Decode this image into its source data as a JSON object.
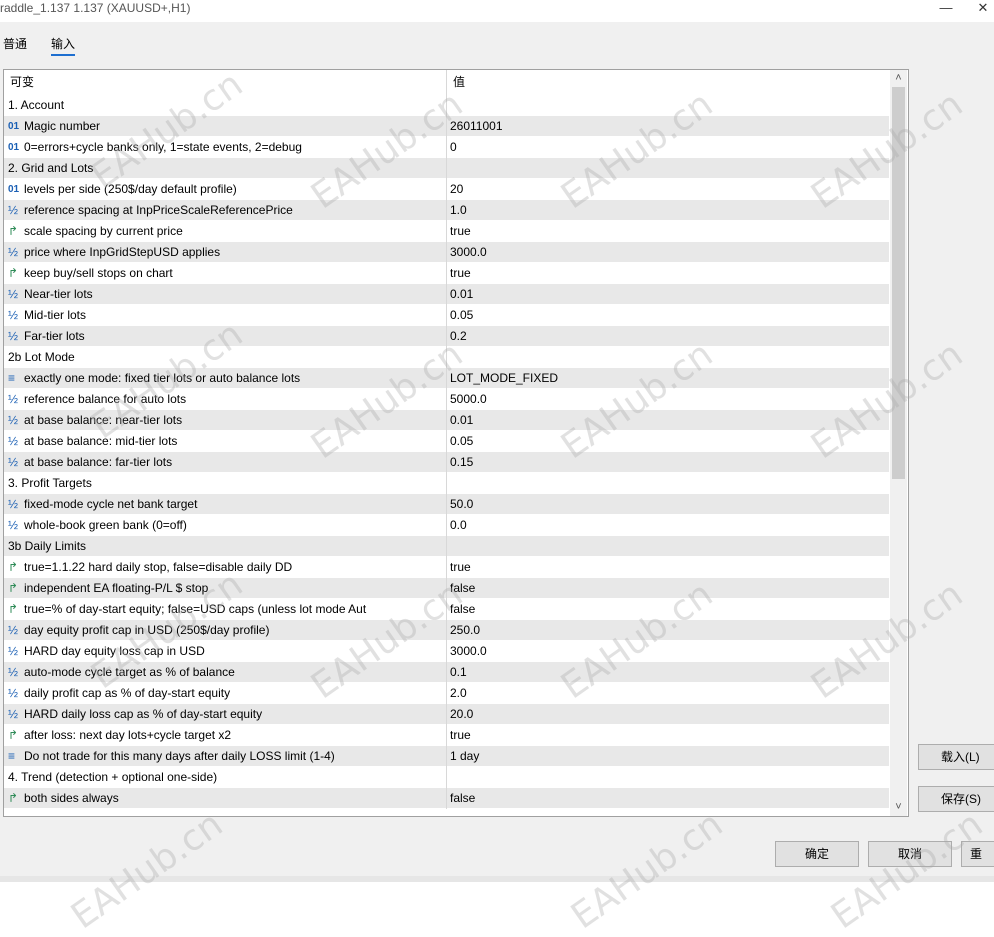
{
  "window": {
    "title": "raddle_1.137 1.137 (XAUUSD+,H1)",
    "minimize_glyph": "—",
    "close_glyph": "✕"
  },
  "tabs": [
    {
      "label": "普通"
    },
    {
      "label": "输入"
    }
  ],
  "grid": {
    "header_variable": "可变",
    "header_value": "值",
    "rows": [
      {
        "type": "group",
        "name": "1. Account",
        "value": ""
      },
      {
        "type": "param",
        "icon": "01",
        "name": "Magic number",
        "value": "26011001"
      },
      {
        "type": "param",
        "icon": "01",
        "name": "0=errors+cycle banks only, 1=state events, 2=debug",
        "value": "0"
      },
      {
        "type": "group",
        "name": "2. Grid and Lots",
        "value": ""
      },
      {
        "type": "param",
        "icon": "01",
        "name": "levels per side (250$/day default profile)",
        "value": "20"
      },
      {
        "type": "param",
        "icon": "½",
        "name": "reference spacing at InpPriceScaleReferencePrice",
        "value": "1.0"
      },
      {
        "type": "param",
        "icon": "↱",
        "name": "scale spacing by current price",
        "value": "true"
      },
      {
        "type": "param",
        "icon": "½",
        "name": "price where InpGridStepUSD applies",
        "value": "3000.0"
      },
      {
        "type": "param",
        "icon": "↱",
        "name": "keep buy/sell stops on chart",
        "value": "true"
      },
      {
        "type": "param",
        "icon": "½",
        "name": "Near-tier lots",
        "value": "0.01"
      },
      {
        "type": "param",
        "icon": "½",
        "name": "Mid-tier lots",
        "value": "0.05"
      },
      {
        "type": "param",
        "icon": "½",
        "name": "Far-tier lots",
        "value": "0.2"
      },
      {
        "type": "group",
        "name": "2b Lot Mode",
        "value": ""
      },
      {
        "type": "param",
        "icon": "≡",
        "name": "exactly one mode: fixed tier lots or auto balance lots",
        "value": "LOT_MODE_FIXED"
      },
      {
        "type": "param",
        "icon": "½",
        "name": "reference balance for auto lots",
        "value": "5000.0"
      },
      {
        "type": "param",
        "icon": "½",
        "name": "at base balance: near-tier lots",
        "value": "0.01"
      },
      {
        "type": "param",
        "icon": "½",
        "name": "at base balance: mid-tier lots",
        "value": "0.05"
      },
      {
        "type": "param",
        "icon": "½",
        "name": "at base balance: far-tier lots",
        "value": "0.15"
      },
      {
        "type": "group",
        "name": "3. Profit Targets",
        "value": ""
      },
      {
        "type": "param",
        "icon": "½",
        "name": "fixed-mode cycle net bank target",
        "value": "50.0"
      },
      {
        "type": "param",
        "icon": "½",
        "name": "whole-book green bank (0=off)",
        "value": "0.0"
      },
      {
        "type": "group",
        "name": "3b Daily Limits",
        "value": ""
      },
      {
        "type": "param",
        "icon": "↱",
        "name": "true=1.1.22 hard daily stop, false=disable daily DD",
        "value": "true"
      },
      {
        "type": "param",
        "icon": "↱",
        "name": "independent EA floating-P/L $ stop",
        "value": "false"
      },
      {
        "type": "param",
        "icon": "↱",
        "name": "true=% of day-start equity; false=USD caps (unless lot mode Aut",
        "value": "false"
      },
      {
        "type": "param",
        "icon": "½",
        "name": "day equity profit cap in USD (250$/day profile)",
        "value": "250.0"
      },
      {
        "type": "param",
        "icon": "½",
        "name": "HARD day equity loss cap in USD",
        "value": "3000.0"
      },
      {
        "type": "param",
        "icon": "½",
        "name": "auto-mode cycle target as % of balance",
        "value": "0.1"
      },
      {
        "type": "param",
        "icon": "½",
        "name": "daily profit cap as % of day-start equity",
        "value": "2.0"
      },
      {
        "type": "param",
        "icon": "½",
        "name": "HARD daily loss cap as % of day-start equity",
        "value": "20.0"
      },
      {
        "type": "param",
        "icon": "↱",
        "name": "after loss: next day lots+cycle target x2",
        "value": "true"
      },
      {
        "type": "param",
        "icon": "≡",
        "name": "Do not trade for this many days after daily LOSS limit (1-4)",
        "value": "1 day"
      },
      {
        "type": "group",
        "name": "4. Trend (detection + optional one-side)",
        "value": ""
      },
      {
        "type": "param",
        "icon": "↱",
        "name": "both sides always",
        "value": "false"
      }
    ],
    "scroll_up_glyph": "˄",
    "scroll_down_glyph": "˅"
  },
  "buttons": {
    "load": "载入(L)",
    "save": "保存(S)",
    "ok": "确定",
    "cancel": "取消",
    "reset": "重"
  },
  "watermark": "EAHub.cn"
}
